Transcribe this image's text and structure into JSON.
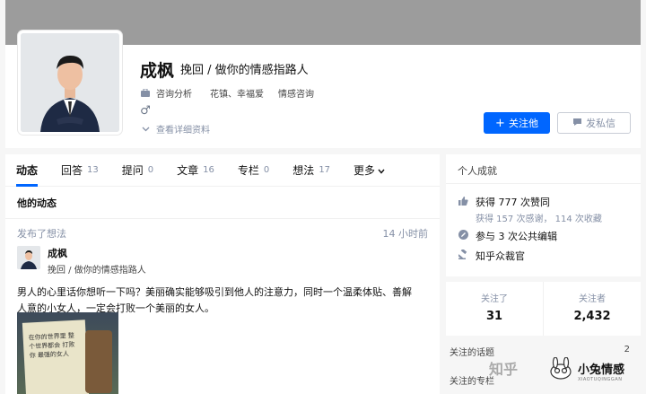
{
  "profile": {
    "name": "成枫",
    "headline": "挽回 / 做你的情感指路人",
    "industry_icon": "briefcase-icon",
    "industry": "咨询分析",
    "companies": "花镇、幸福爱",
    "position": "情感咨询",
    "gender_symbol": "♂",
    "details_label": "查看详细资料",
    "follow_label": "关注他",
    "message_label": "发私信"
  },
  "tabs": [
    {
      "label": "动态",
      "count": ""
    },
    {
      "label": "回答",
      "count": "13"
    },
    {
      "label": "提问",
      "count": "0"
    },
    {
      "label": "文章",
      "count": "16"
    },
    {
      "label": "专栏",
      "count": "0"
    },
    {
      "label": "想法",
      "count": "17"
    },
    {
      "label": "更多",
      "count": ""
    }
  ],
  "feed": {
    "section_title": "他的动态",
    "action": "发布了想法",
    "time": "14 小时前",
    "author_name": "成枫",
    "author_headline": "挽回 / 做你的情感指路人",
    "text": "男人的心里话你想听一下吗？美丽确实能够吸引到他人的注意力，同时一个温柔体贴、善解人意的小女人，一定会打败一个美丽的女人。",
    "image_text": "在你的世界里 整个世界都会 打败你 最强的女人"
  },
  "achievements": {
    "title": "个人成就",
    "likes": "获得 777 次赞同",
    "likes_sub": "获得 157 次感谢， 114 次收藏",
    "edits": "参与 3 次公共编辑",
    "judge": "知乎众裁官"
  },
  "stats": {
    "following_label": "关注了",
    "following": "31",
    "followers_label": "关注者",
    "followers": "2,432"
  },
  "side_links": {
    "topics_label": "关注的话题",
    "topics_count": "2",
    "columns_label": "关注的专栏"
  },
  "watermark": {
    "site": "知乎",
    "brand": "小兔情感",
    "brand_sub": "XIAOTUQINGGAN"
  },
  "colors": {
    "accent": "#0066ff",
    "muted": "#8590a6"
  }
}
